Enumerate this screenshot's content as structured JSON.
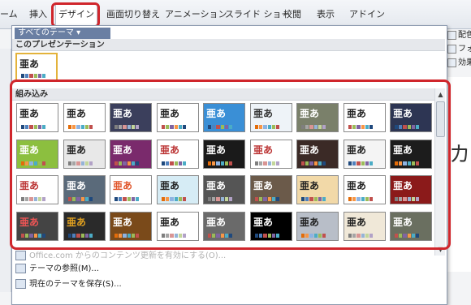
{
  "ribbon": {
    "tabs": [
      {
        "label": "ーム"
      },
      {
        "label": "挿入"
      },
      {
        "label": "デザイン",
        "active": true
      },
      {
        "label": "画面切り替え"
      },
      {
        "label": "アニメーション"
      },
      {
        "label": "スライド ショー"
      },
      {
        "label": "校閲"
      },
      {
        "label": "表示"
      },
      {
        "label": "アドイン"
      }
    ],
    "right_buttons": [
      "配色",
      "フォント",
      "効果"
    ]
  },
  "slide": {
    "partial_text": "カ"
  },
  "gallery": {
    "filter_label": "すべてのテーマ ▾",
    "section_current": "このプレゼンテーション",
    "section_builtin": "組み込み",
    "theme_title_text": "亜あ",
    "footer": {
      "update_label": "Office.com からのコンテンツ更新を有効にする(O)...",
      "browse_label": "テーマの参照(M)...",
      "save_label": "現在のテーマを保存(S)..."
    }
  },
  "colors": {
    "highlight_red": "#d0262c",
    "selected_gold": "#e3b33b"
  }
}
